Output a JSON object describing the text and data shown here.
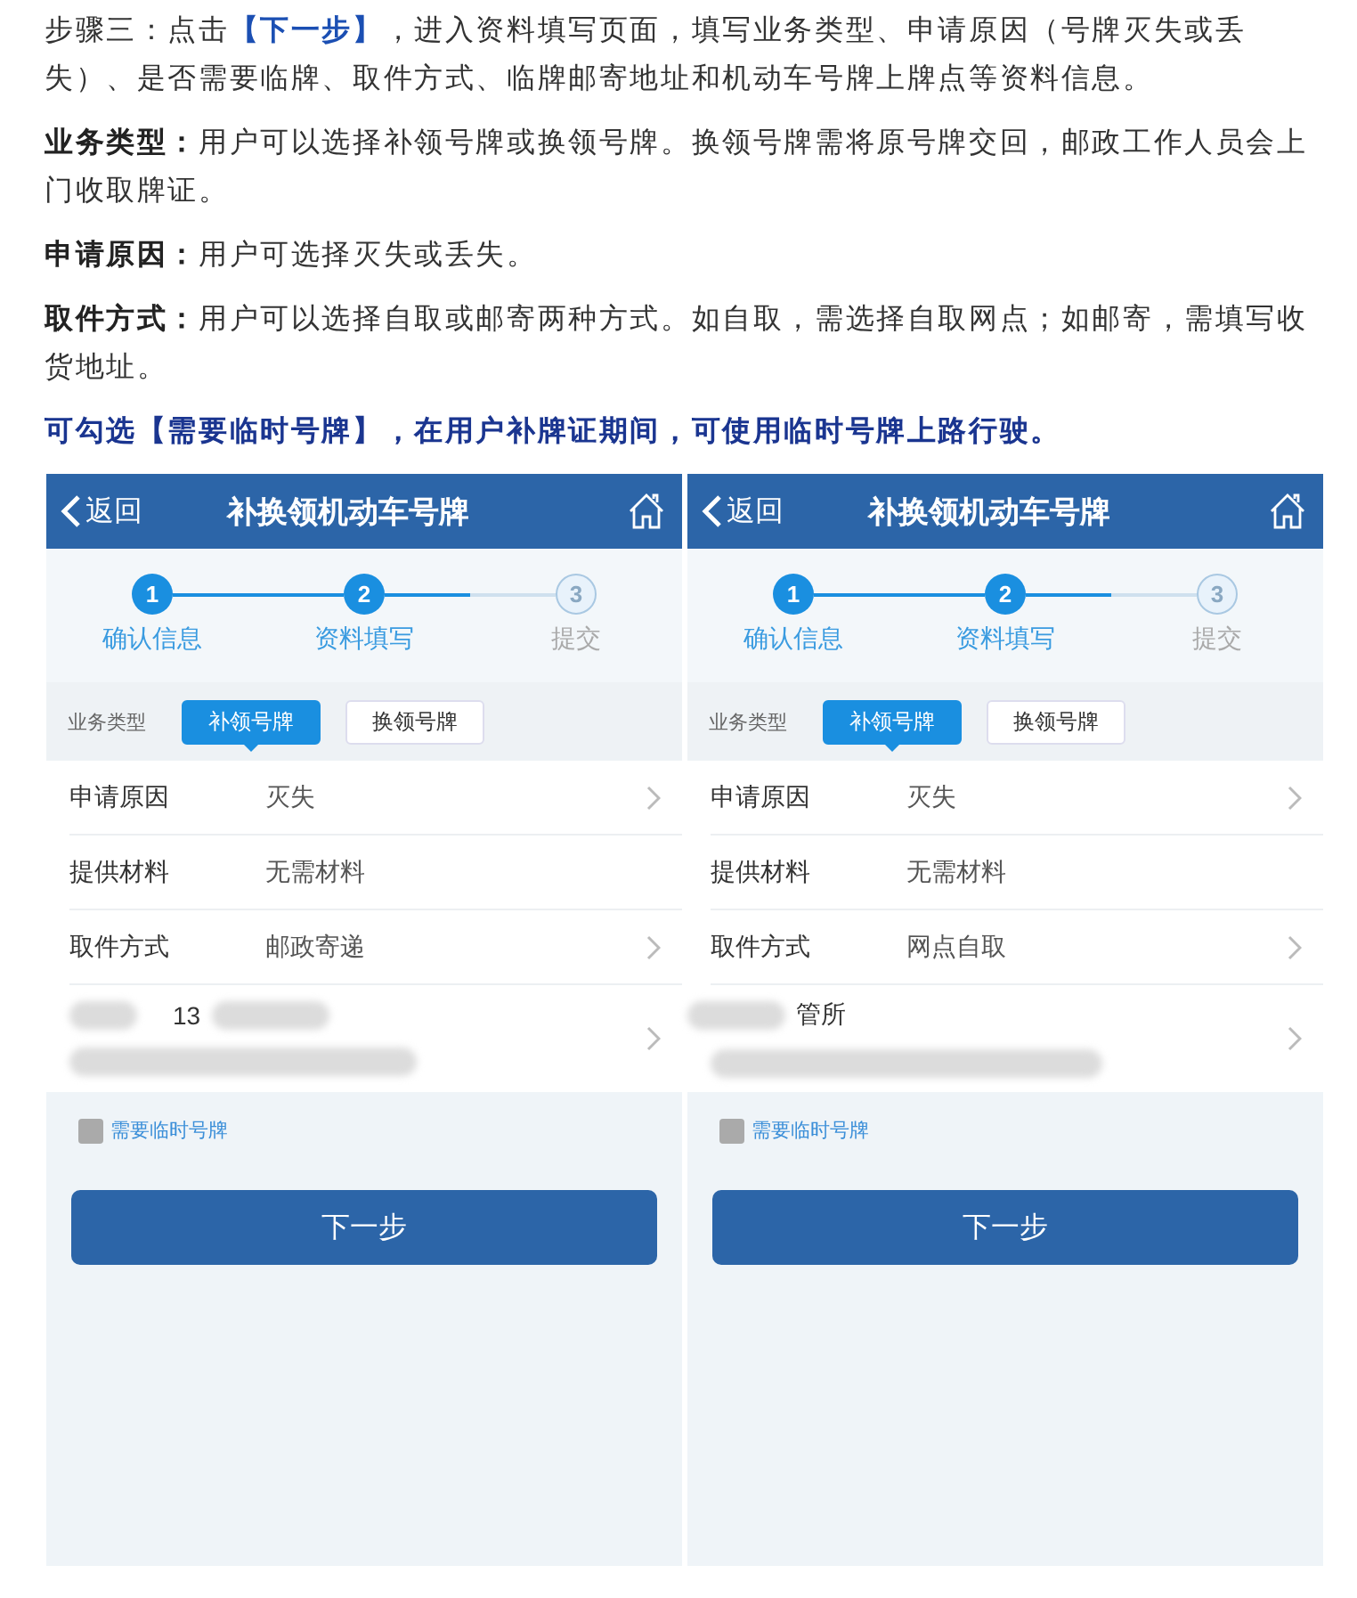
{
  "article": [
    {
      "kind": "step",
      "text": "步骤三：点击**【下一步】**，进入资料填写页面，填写业务类型、申请原因（号牌灭失或丢失）、是否需要临牌、取件方式、临牌邮寄地址和机动车号牌上牌点等资料信息。"
    },
    {
      "kind": "plain",
      "text": "**业务类型：**用户可以选择补领号牌或换领号牌。换领号牌需将原号牌交回，邮政工作人员会上门收取牌证。"
    },
    {
      "kind": "plain",
      "text": "**申请原因：**用户可选择灭失或丢失。"
    },
    {
      "kind": "plain",
      "text": "**取件方式：**用户可以选择自取或邮寄两种方式。如自取，需选择自取网点；如邮寄，需填写收货地址。"
    },
    {
      "kind": "highlight",
      "text": "可勾选【需要临时号牌】，在用户补牌证期间，可使用临时号牌上路行驶。"
    }
  ],
  "phones": [
    {
      "back": "返回",
      "title": "补换领机动车号牌",
      "steps": [
        {
          "number": "1",
          "label": "确认信息",
          "completed": true
        },
        {
          "number": "2",
          "label": "资料填写",
          "completed": true
        },
        {
          "number": "3",
          "label": "提交",
          "completed": false
        }
      ],
      "type_label": "业务类型",
      "type_options": [
        {
          "label": "补领号牌",
          "selected": true
        },
        {
          "label": "换领号牌",
          "selected": false
        }
      ],
      "rows": [
        {
          "label": "申请原因",
          "value": "灭失",
          "has_arrow": true
        },
        {
          "label": "提供材料",
          "value": "无需材料",
          "has_arrow": false
        },
        {
          "label": "取件方式",
          "value": "邮政寄递",
          "has_arrow": true
        }
      ],
      "address": {
        "kind": "phone",
        "text": "13"
      },
      "checkbox": {
        "label": "需要临时号牌",
        "checked": false
      },
      "button": "下一步"
    },
    {
      "back": "返回",
      "title": "补换领机动车号牌",
      "steps": [
        {
          "number": "1",
          "label": "确认信息",
          "completed": true
        },
        {
          "number": "2",
          "label": "资料填写",
          "completed": true
        },
        {
          "number": "3",
          "label": "提交",
          "completed": false
        }
      ],
      "type_label": "业务类型",
      "type_options": [
        {
          "label": "补领号牌",
          "selected": true
        },
        {
          "label": "换领号牌",
          "selected": false
        }
      ],
      "rows": [
        {
          "label": "申请原因",
          "value": "灭失",
          "has_arrow": true
        },
        {
          "label": "提供材料",
          "value": "无需材料",
          "has_arrow": false
        },
        {
          "label": "取件方式",
          "value": "网点自取",
          "has_arrow": true
        }
      ],
      "address": {
        "kind": "office",
        "text": "管所"
      },
      "checkbox": {
        "label": "需要临时号牌",
        "checked": false
      },
      "button": "下一步"
    }
  ]
}
